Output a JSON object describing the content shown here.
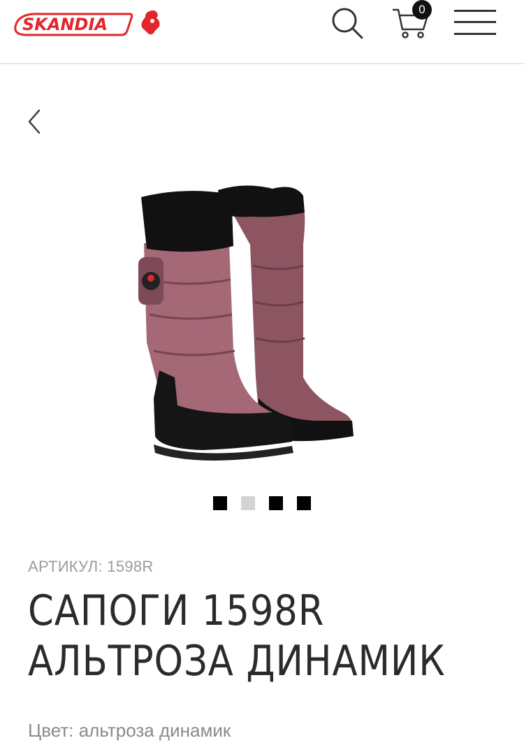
{
  "header": {
    "brand": "SKANDIA",
    "cart_count": "0",
    "icons": [
      "logo",
      "search-icon",
      "cart-icon",
      "menu-icon"
    ]
  },
  "nav": {
    "back_icon": "chevron-left-icon"
  },
  "gallery": {
    "image": "boots-pair-image",
    "dots": [
      {
        "active": true
      },
      {
        "active": false
      },
      {
        "active": true
      },
      {
        "active": true
      }
    ]
  },
  "product": {
    "sku": "АРТИКУЛ: 1598R",
    "title_line1": "САПОГИ 1598R",
    "title_line2": "АЛЬТРОЗА ДИНАМИК",
    "color": "Цвет: альтроза динамик"
  },
  "colors": {
    "brand_red": "#e2262a",
    "text_dark": "#2b2b2b",
    "text_muted": "#9b9b9b"
  }
}
